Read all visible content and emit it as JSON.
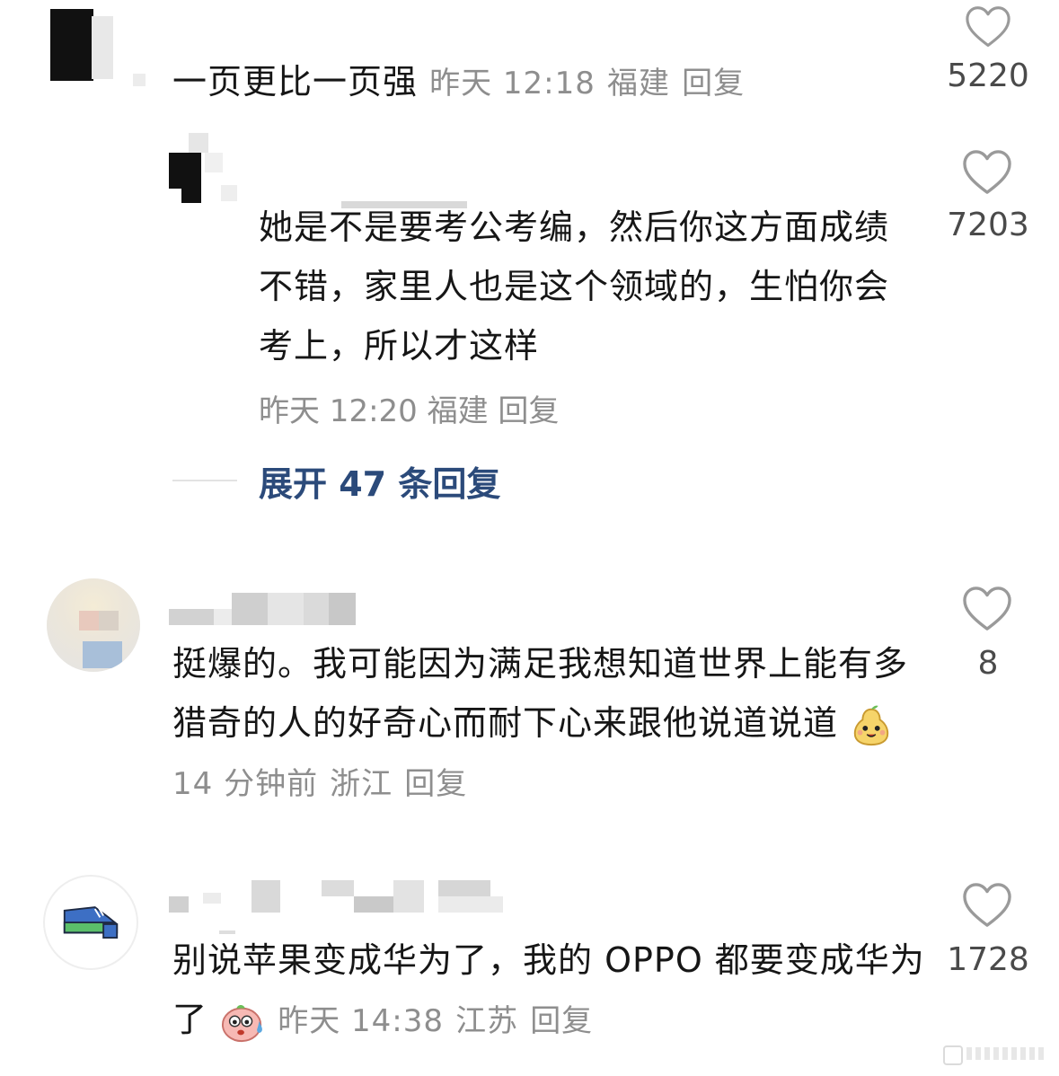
{
  "comments": [
    {
      "text": "一页更比一页强",
      "time": "昨天 12:18",
      "location": "福建",
      "reply_label": "回复",
      "likes": "5220"
    },
    {
      "text": "她是不是要考公考编，然后你这方面成绩不错，家里人也是这个领域的，生怕你会考上，所以才这样",
      "time": "昨天 12:20",
      "location": "福建",
      "reply_label": "回复",
      "likes": "7203"
    },
    {
      "text": "挺爆的。我可能因为满足我想知道世界上能有多猎奇的人的好奇心而耐下心来跟他说道说道",
      "time": "14 分钟前",
      "location": "浙江",
      "reply_label": "回复",
      "likes": "8"
    },
    {
      "text": "别说苹果变成华为了，我的 OPPO 都要变成华为了",
      "time": "昨天 14:38",
      "location": "江苏",
      "reply_label": "回复",
      "likes": "1728"
    }
  ],
  "expand_replies": "展开 47 条回复",
  "colors": {
    "text": "#161616",
    "meta": "#8e8e8e",
    "link": "#2b4a7a",
    "like_icon": "#9a9a9a"
  }
}
